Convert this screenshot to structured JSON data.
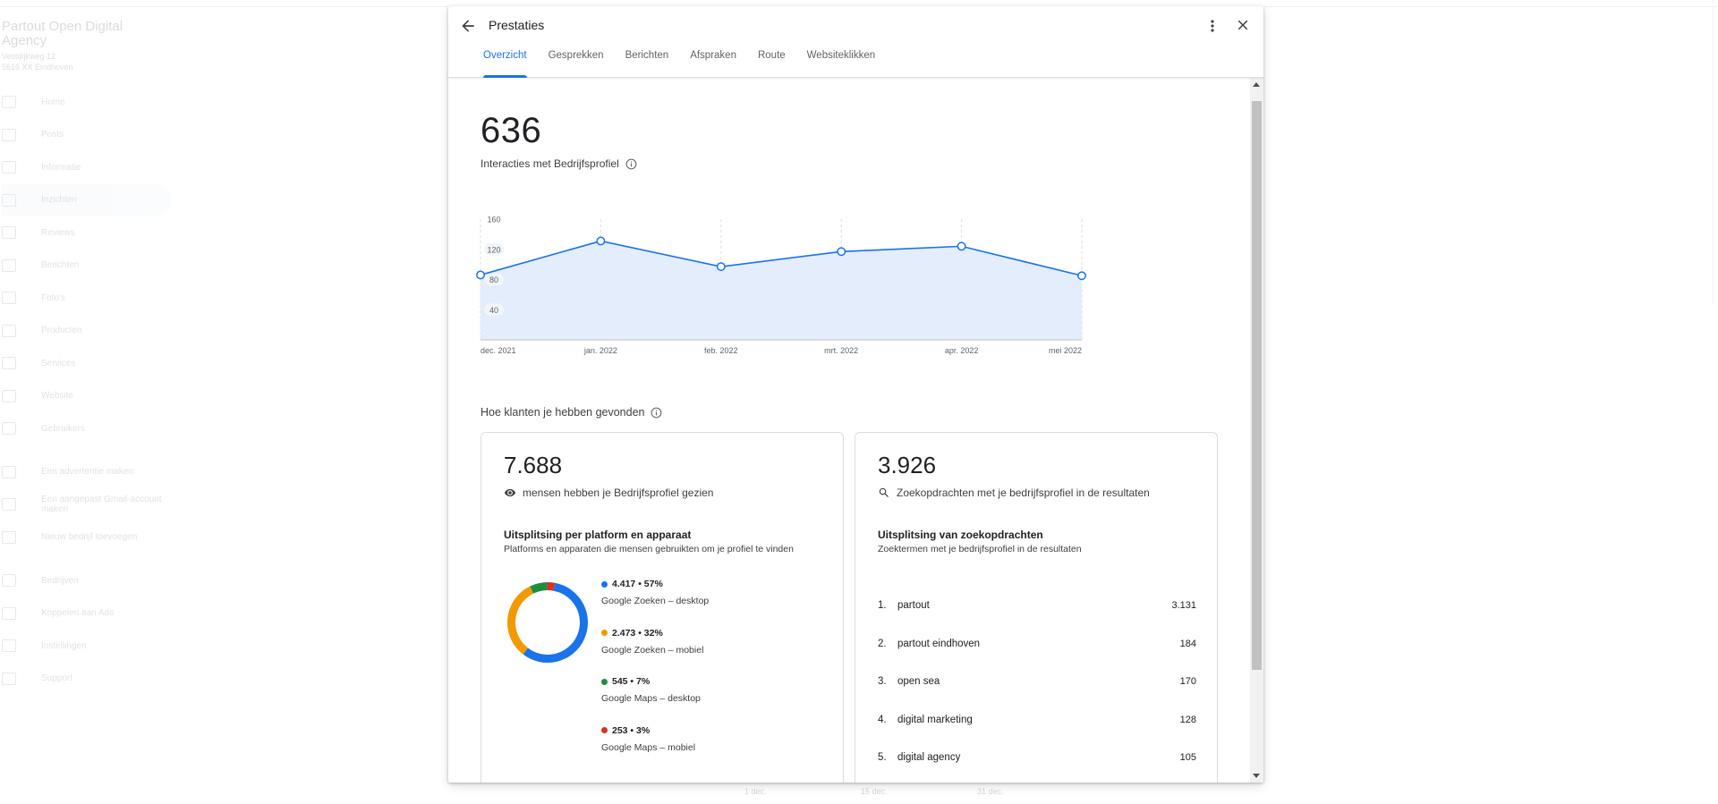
{
  "background": {
    "brand": "Partout Open Digital Agency",
    "address_line1": "Vestdijkweg 12",
    "address_line2": "5616 XX Eindhoven",
    "nav": [
      "Home",
      "Posts",
      "Informatie",
      "Inzichten",
      "Reviews",
      "Berichten",
      "Foto's",
      "Producten",
      "Services",
      "Website",
      "Gebruikers"
    ],
    "nav_extra": [
      "Een advertentie maken",
      "Een aangepast Gmail-account maken",
      "Nieuw bedrijf toevoegen"
    ],
    "nav_bottom": [
      "Bedrijven",
      "Koppelen aan Ads",
      "Instellingen",
      "Support"
    ],
    "bottom_labels": [
      "1 dec.",
      "15 dec.",
      "31 dec."
    ]
  },
  "dialog": {
    "title": "Prestaties",
    "tabs": [
      "Overzicht",
      "Gesprekken",
      "Berichten",
      "Afspraken",
      "Route",
      "Websiteklikken"
    ],
    "active_tab": "Overzicht"
  },
  "summary": {
    "total": "636",
    "label": "Interacties met Bedrijfsprofiel"
  },
  "chart_data": {
    "type": "area",
    "x": [
      "dec. 2021",
      "jan. 2022",
      "feb. 2022",
      "mrt. 2022",
      "apr. 2022",
      "mei 2022"
    ],
    "values": [
      86,
      131,
      97,
      117,
      124,
      85
    ],
    "y_ticks": [
      40,
      80,
      120,
      160
    ],
    "ylim": [
      0,
      160
    ],
    "color": "#1a73e8",
    "fill": "#e3edfb"
  },
  "discovery": {
    "title": "Hoe klanten je hebben gevonden"
  },
  "views_card": {
    "total": "7.688",
    "subtitle": "mensen hebben je Bedrijfsprofiel gezien",
    "heading": "Uitsplitsing per platform en apparaat",
    "description": "Platforms en apparaten die mensen gebruikten om je profiel te vinden",
    "breakdown": [
      {
        "value": "4.417 • 57%",
        "label": "Google Zoeken – desktop",
        "color": "#1a73e8",
        "share": 57
      },
      {
        "value": "2.473 • 32%",
        "label": "Google Zoeken – mobiel",
        "color": "#f29900",
        "share": 32
      },
      {
        "value": "545 • 7%",
        "label": "Google Maps – desktop",
        "color": "#1e8e3e",
        "share": 7
      },
      {
        "value": "253 • 3%",
        "label": "Google Maps – mobiel",
        "color": "#d93025",
        "share": 3
      }
    ]
  },
  "search_card": {
    "total": "3.926",
    "subtitle": "Zoekopdrachten met je bedrijfsprofiel in de resultaten",
    "heading": "Uitsplitsing van zoekopdrachten",
    "description": "Zoektermen met je bedrijfsprofiel in de resultaten",
    "terms": [
      {
        "rank": "1.",
        "term": "partout",
        "count": "3.131"
      },
      {
        "rank": "2.",
        "term": "partout eindhoven",
        "count": "184"
      },
      {
        "rank": "3.",
        "term": "open sea",
        "count": "170"
      },
      {
        "rank": "4.",
        "term": "digital marketing",
        "count": "128"
      },
      {
        "rank": "5.",
        "term": "digital agency",
        "count": "105"
      }
    ]
  }
}
